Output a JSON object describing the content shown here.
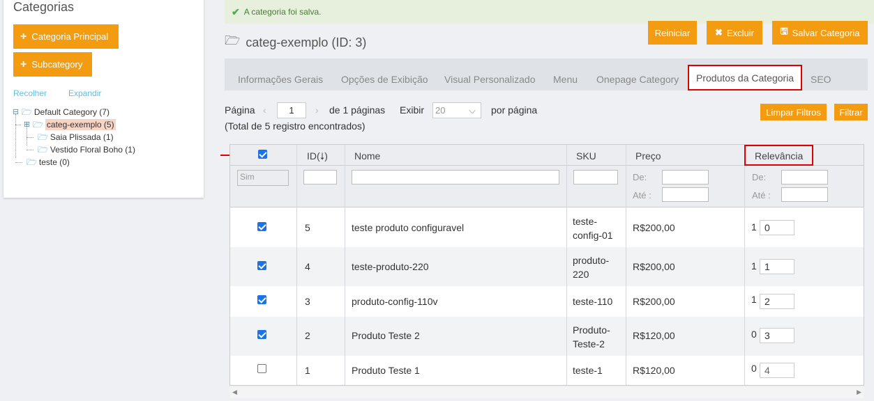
{
  "sidebar": {
    "title": "Categorias",
    "btn_main": "Categoria Principal",
    "btn_sub": "Subcategory",
    "collapse": "Recolher",
    "expand": "Expandir",
    "tree": [
      {
        "label": "Default Category (7)"
      },
      {
        "label": "categ-exemplo (5)"
      },
      {
        "label": "Saia Plissada (1)"
      },
      {
        "label": "Vestido Floral Boho (1)"
      },
      {
        "label": "teste (0)"
      }
    ]
  },
  "alert": {
    "message": "A categoria foi salva."
  },
  "header": {
    "title": "categ-exemplo (ID: 3)",
    "btn_reset": "Reiniciar",
    "btn_delete": "Excluir",
    "btn_save": "Salvar Categoria"
  },
  "tabs": [
    {
      "label": "Informações Gerais"
    },
    {
      "label": "Opções de Exibição"
    },
    {
      "label": "Visual Personalizado"
    },
    {
      "label": "Menu"
    },
    {
      "label": "Onepage Category"
    },
    {
      "label": "Produtos da Categoria"
    },
    {
      "label": "SEO"
    }
  ],
  "pager": {
    "page_label": "Página",
    "page_value": "1",
    "of_pages": "de 1 páginas",
    "show_label": "Exibir",
    "per_page_value": "20",
    "per_page_label": "por página",
    "total": "(Total de 5 registro encontrados)",
    "btn_clear": "Limpar Filtros",
    "btn_filter": "Filtrar"
  },
  "grid": {
    "headers": {
      "id": "ID",
      "name": "Nome",
      "sku": "SKU",
      "price": "Preço",
      "relevance": "Relevância"
    },
    "filters": {
      "sim_placeholder": "Sim",
      "from": "De:",
      "to": "Até :"
    },
    "rows": [
      {
        "checked": true,
        "id": "5",
        "name": "teste produto configuravel",
        "sku": "teste-\nconfig-01",
        "price": "R$200,00",
        "rel_prefix": "1",
        "relevance": "0"
      },
      {
        "checked": true,
        "id": "4",
        "name": "teste-produto-220",
        "sku": "produto-\n220",
        "price": "R$200,00",
        "rel_prefix": "1",
        "relevance": "1"
      },
      {
        "checked": true,
        "id": "3",
        "name": "produto-config-110v",
        "sku": "teste-110",
        "price": "R$200,00",
        "rel_prefix": "1",
        "relevance": "2"
      },
      {
        "checked": true,
        "id": "2",
        "name": "Produto Teste 2",
        "sku": "Produto-\nTeste-2",
        "price": "R$120,00",
        "rel_prefix": "0",
        "relevance": "3"
      },
      {
        "checked": false,
        "id": "1",
        "name": "Produto Teste 1",
        "sku": "teste-1",
        "price": "R$120,00",
        "rel_prefix": "0",
        "relevance": "4"
      }
    ]
  },
  "colors": {
    "accent": "#f39c12",
    "highlight": "#e00000",
    "checkbox": "#1a73e8"
  }
}
